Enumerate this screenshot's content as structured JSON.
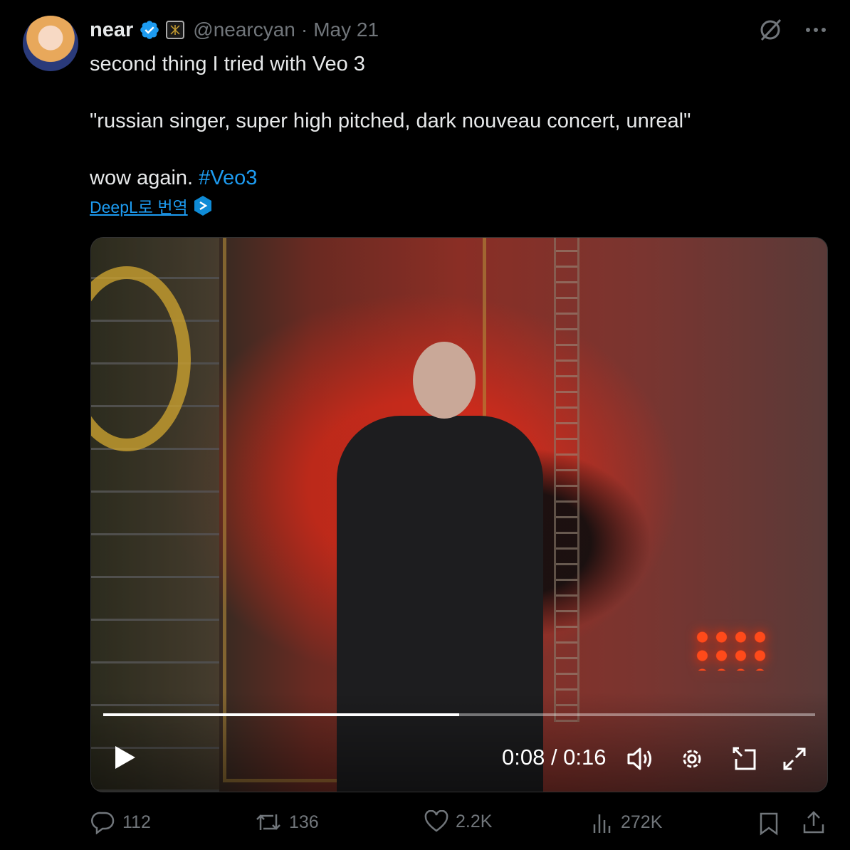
{
  "author": {
    "name": "near",
    "handle": "@nearcyan",
    "separator": "·",
    "date": "May 21"
  },
  "tweet": {
    "line1": "second thing I tried with Veo 3",
    "line2": "\"russian singer, super high pitched, dark nouveau concert, unreal\"",
    "line3_text": "wow again. ",
    "hashtag": "#Veo3"
  },
  "translate_link": "DeepL로 번역",
  "video": {
    "time_display": "0:08 / 0:16",
    "progress": 0.5
  },
  "actions": {
    "replies": "112",
    "reposts": "136",
    "likes": "2.2K",
    "views": "272K"
  },
  "colors": {
    "accent": "#1d9bf0",
    "muted": "#71767b",
    "text": "#e7e9ea",
    "background": "#000000"
  },
  "icons": [
    "verified-badge-icon",
    "affiliate-badge-icon",
    "grok-icon",
    "more-icon",
    "deepl-icon",
    "play-icon",
    "volume-icon",
    "settings-icon",
    "pip-icon",
    "fullscreen-icon",
    "reply-icon",
    "repost-icon",
    "like-icon",
    "views-icon",
    "bookmark-icon",
    "share-icon"
  ]
}
